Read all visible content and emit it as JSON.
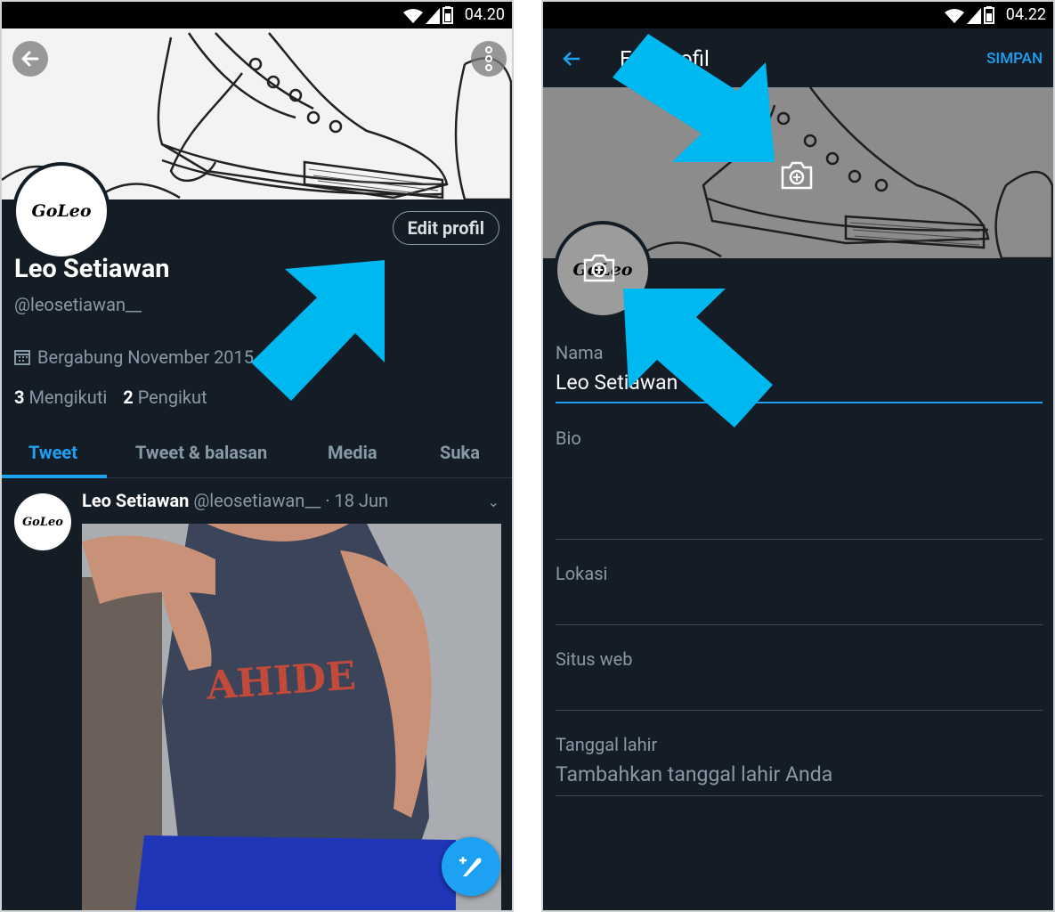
{
  "left": {
    "status": {
      "time": "04.20"
    },
    "avatar_text": "GoLeo",
    "edit_button": "Edit profil",
    "name": "Leo Setiawan",
    "handle": "@leosetiawan__",
    "joined": "Bergabung November 2015",
    "following_count": "3",
    "following_label": "Mengikuti",
    "followers_count": "2",
    "followers_label": "Pengikut",
    "tabs": [
      "Tweet",
      "Tweet & balasan",
      "Media",
      "Suka"
    ],
    "tweet": {
      "author": "Leo Setiawan",
      "meta": "@leosetiawan__ · 18 Jun"
    },
    "shirt_text": "AHIDE"
  },
  "right": {
    "status": {
      "time": "04.22"
    },
    "title": "Edit profil",
    "save": "SIMPAN",
    "avatar_text": "GoLeo",
    "fields": {
      "name_label": "Nama",
      "name_value": "Leo Setiawan",
      "bio_label": "Bio",
      "location_label": "Lokasi",
      "website_label": "Situs web",
      "birth_label": "Tanggal lahir",
      "birth_placeholder": "Tambahkan tanggal lahir Anda"
    }
  },
  "colors": {
    "accent": "#1da1f2",
    "background": "#141d26",
    "annotation_arrow": "#00b8f0"
  },
  "icons": [
    "back-arrow-icon",
    "more-vert-icon",
    "calendar-icon",
    "chevron-down-icon",
    "compose-tweet-icon",
    "camera-add-icon",
    "wifi-icon",
    "signal-icon",
    "battery-icon"
  ]
}
